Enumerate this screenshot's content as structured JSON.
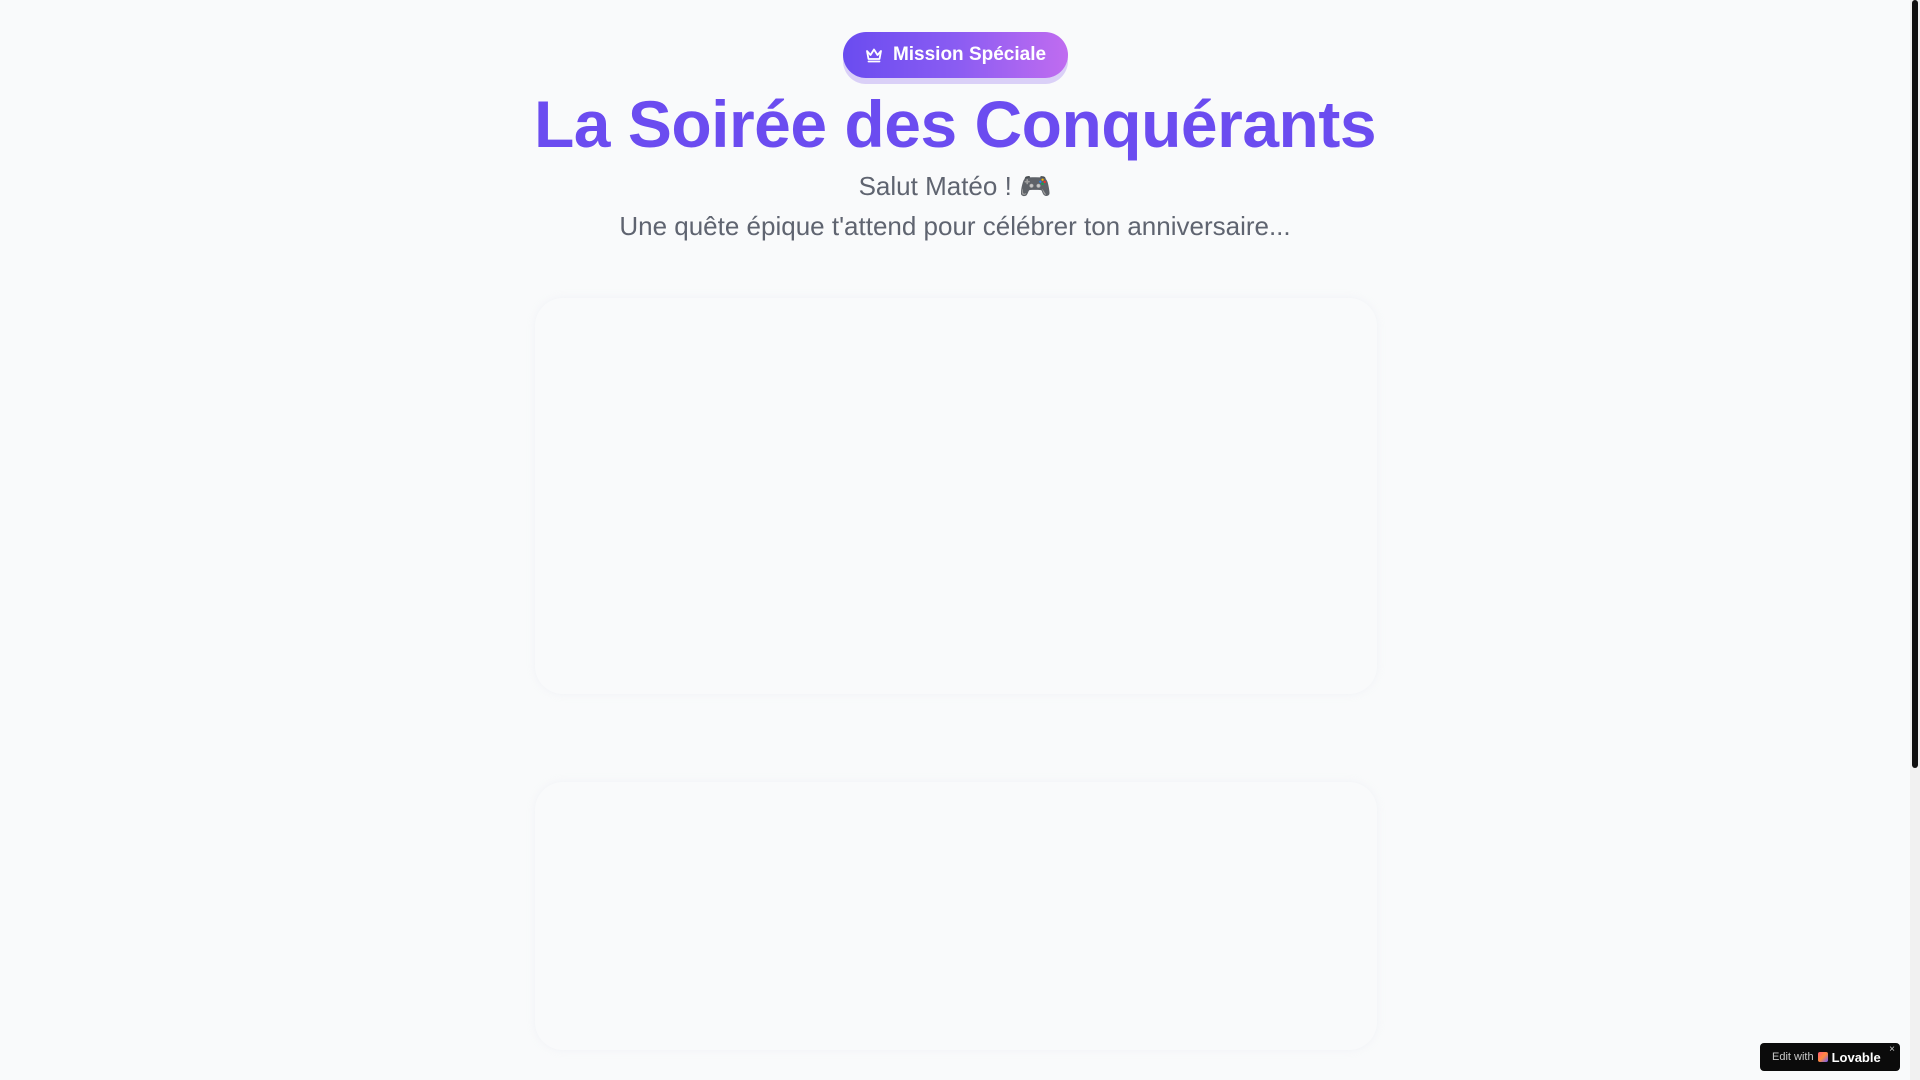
{
  "badge": {
    "icon": "crown-icon",
    "label": "Mission Spéciale"
  },
  "hero": {
    "title": "La Soirée des Conquérants",
    "greeting": "Salut Matéo ! 🎮",
    "subtitle": "Une quête épique t'attend pour célébrer ton anniversaire..."
  },
  "lovable": {
    "edit_label": "Edit with",
    "brand": "Lovable",
    "close": "×"
  },
  "colors": {
    "accent": "#6b4cf0",
    "badge_start": "#6a4cf0",
    "badge_end": "#c06cf0",
    "background": "#f9fafb",
    "muted_text": "#5f6470"
  }
}
